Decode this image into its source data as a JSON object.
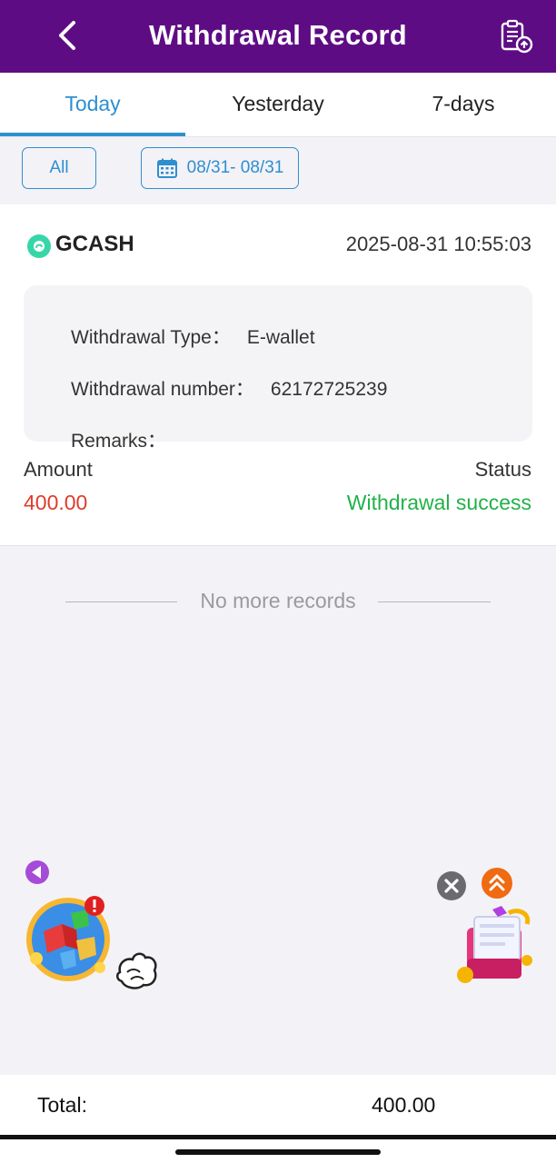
{
  "header": {
    "title": "Withdrawal Record",
    "back_icon": "chevron-left-icon",
    "export_icon": "clipboard-upload-icon",
    "background_color": "#5e0c84"
  },
  "tabs": [
    {
      "label": "Today",
      "active": true
    },
    {
      "label": "Yesterday",
      "active": false
    },
    {
      "label": "7-days",
      "active": false
    }
  ],
  "filters": {
    "type_label": "All",
    "date_range": "08/31- 08/31",
    "date_icon": "calendar-icon"
  },
  "record": {
    "channel": "GCASH",
    "channel_icon": "gcash-logo-icon",
    "datetime": "2025-08-31 10:55:03",
    "type_label": "Withdrawal Type：",
    "type_value": "E-wallet",
    "number_label": "Withdrawal number：",
    "number_value": "62172725239",
    "remarks_label": "Remarks：",
    "amount_label": "Amount",
    "amount_value": "400.00",
    "status_label": "Status",
    "status_value": "Withdrawal success",
    "amount_color": "#e03b2c",
    "status_color": "#21b24a"
  },
  "list_end_text": "No more records",
  "footer": {
    "total_label": "Total:",
    "total_value": "400.00"
  },
  "floating": {
    "left_collapse_icon": "triangle-left-icon",
    "game_icon": "cube-game-icon",
    "chat_icon": "hand-pointer-icon",
    "close_icon": "close-icon",
    "scroll_top_icon": "double-chevron-up-icon",
    "gift_icon": "gift-box-icon"
  },
  "accent_color": "#2e8fcf"
}
